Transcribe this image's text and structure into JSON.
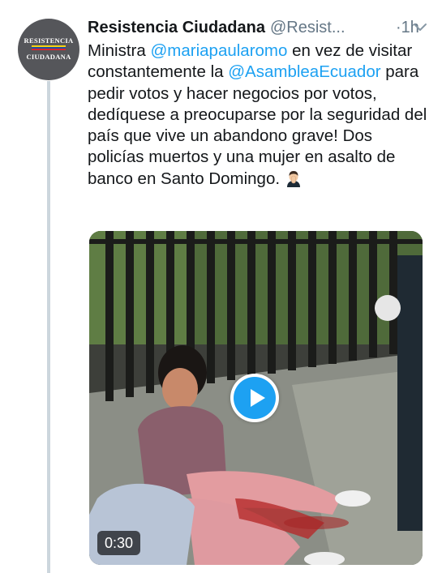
{
  "tweet": {
    "author": {
      "display_name": "Resistencia Ciudadana",
      "handle": "@Resist...",
      "avatar": {
        "line1": "RESISTENCIA",
        "line2": "CIUDADANA",
        "flag_colors": [
          "#f6d10c",
          "#1f4fa1",
          "#d8262e"
        ]
      }
    },
    "time_sep": "·",
    "time": "1h",
    "menu_icon": "chevron-down-icon",
    "text": {
      "part1": "Ministra ",
      "mention1": "@mariapaularomo",
      "part2": " en vez de visitar constantemente la ",
      "mention2": "@AsambleaEcuador",
      "part3": " para pedir votos y hacer negocios por votos, dedíquese a preocuparse por la seguridad del país que vive un abandono grave! Dos policías muertos y una mujer en asalto de banco en Santo Domingo.",
      "emoji": "man-facepalming-emoji"
    },
    "media": {
      "type": "video",
      "duration": "0:30",
      "play_icon": "play-icon"
    }
  },
  "colors": {
    "link": "#1da1f2",
    "muted": "#657786",
    "thread_line": "#ccd6dd",
    "play_button": "#1da1f2"
  }
}
